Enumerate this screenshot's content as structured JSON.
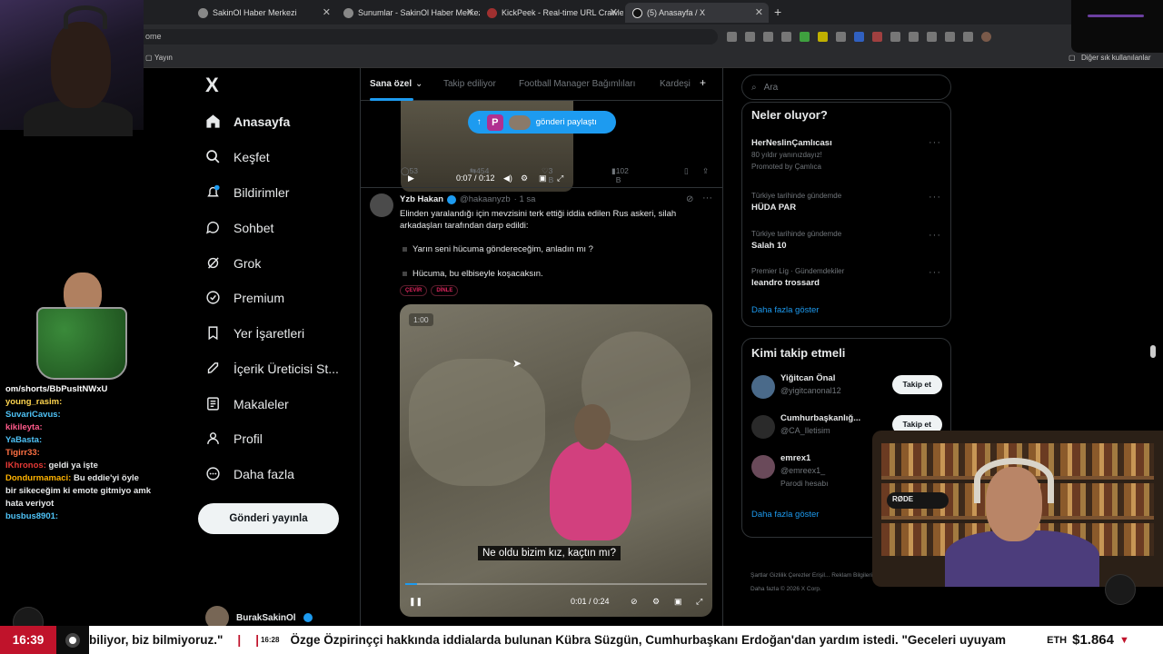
{
  "browser": {
    "tabs": [
      {
        "label": "SakinOl Haber Merkezi"
      },
      {
        "label": "Sunumlar - SakinOl Haber Merkezi"
      },
      {
        "label": "KickPeek - Real-time URL Crawler"
      },
      {
        "label": "(5) Anasayfa / X"
      }
    ],
    "address_fragment": "ome",
    "bookmarks": {
      "left": "Yayın",
      "right": "Diğer sık kullanılanlar"
    }
  },
  "x_nav": {
    "logo": "X",
    "items": [
      {
        "label": "Anasayfa",
        "icon": "home-icon"
      },
      {
        "label": "Keşfet",
        "icon": "search-icon"
      },
      {
        "label": "Bildirimler",
        "icon": "bell-icon"
      },
      {
        "label": "Sohbet",
        "icon": "chat-icon"
      },
      {
        "label": "Grok",
        "icon": "grok-icon"
      },
      {
        "label": "Premium",
        "icon": "premium-icon"
      },
      {
        "label": "Yer İşaretleri",
        "icon": "bookmark-icon"
      },
      {
        "label": "İçerik Üreticisi St...",
        "icon": "rocket-icon"
      },
      {
        "label": "Makaleler",
        "icon": "article-icon"
      },
      {
        "label": "Profil",
        "icon": "profile-icon"
      },
      {
        "label": "Daha fazla",
        "icon": "more-icon"
      }
    ],
    "post_button": "Gönderi yayınla",
    "account_name": "BurakSakinOl"
  },
  "feed": {
    "tabs": [
      "Sana özel",
      "Takip ediliyor",
      "Football Manager Bağımlıları",
      "Kardeşi"
    ],
    "share_pill": "gönderi paylaştı",
    "prev_video_time": "0:07 / 0:12",
    "prev_actions": {
      "replies": "53",
      "reposts": "454",
      "likes": "3 B",
      "views": "102 B"
    },
    "tweet": {
      "name": "Yzb Hakan",
      "handle": "@hakaanyzb",
      "time": "· 1 sa",
      "text": "Elinden yaralandığı için mevzisini terk ettiği iddia edilen Rus askeri, silah arkadaşları tarafından darp edildi:",
      "quote1": "Yarın seni hücuma göndereceğim, anladın mı ?",
      "quote2": "Hücuma, bu elbiseyle koşacaksın.",
      "pill1": "ÇEVİR",
      "pill2": "DİNLE",
      "video_badge": "1:00",
      "subtitle": "Ne oldu bizim kız, kaçtın mı?",
      "video_time": "0:01 / 0:24",
      "progress": 0.04
    }
  },
  "sidebar": {
    "search_placeholder": "Ara",
    "trends_title": "Neler oluyor?",
    "trends": [
      {
        "context": "",
        "title": "HerNeslinÇamlıcası",
        "sub1": "80 yıldır yanınızdayız!",
        "sub2": "Promoted by Çamlıca"
      },
      {
        "context": "Türkiye tarihinde gündemde",
        "title": "HÜDA PAR",
        "sub1": "",
        "sub2": ""
      },
      {
        "context": "Türkiye tarihinde gündemde",
        "title": "Salah 10",
        "sub1": "",
        "sub2": ""
      },
      {
        "context": "Premier Lig · Gündemdekiler",
        "title": "leandro trossard",
        "sub1": "",
        "sub2": ""
      }
    ],
    "trends_more": "Daha fazla göster",
    "who_title": "Kimi takip etmeli",
    "who": [
      {
        "name": "Yiğitcan Önal",
        "handle": "@yigitcanonal12",
        "extra": "",
        "button": "Takip et"
      },
      {
        "name": "Cumhurbaşkanlığ...",
        "handle": "@CA_Iletisim",
        "extra": "",
        "button": "Takip et"
      },
      {
        "name": "emrex1",
        "handle": "@emreex1_",
        "extra": "Parodi hesabı",
        "button": ""
      }
    ],
    "who_more": "Daha fazla göster",
    "footer": "Şartlar   Gizlilik   Çerezler   Erişil... Reklam Bilgileri   Daha fazla   © 2026 X Corp."
  },
  "chat": {
    "header": "om/shorts/BbPusltNWxU",
    "messages": [
      {
        "user": "young_rasim:",
        "text": "",
        "color": "#ffd54f"
      },
      {
        "user": "SuvariCavus:",
        "text": "",
        "color": "#4fc3f7"
      },
      {
        "user": "kikileyta:",
        "text": "",
        "color": "#ff5a8a"
      },
      {
        "user": "YaBasta:",
        "text": "",
        "color": "#4fc3f7"
      },
      {
        "user": "Tigirr33:",
        "text": "",
        "color": "#ff7043"
      },
      {
        "user": "IKhronos:",
        "text": "geldi ya işte",
        "color": "#e53935"
      },
      {
        "user": "Dondurmamaci:",
        "text": "Bu eddie'yi öyle bir sikeceğim ki emote gitmiyo amk hata veriyot",
        "color": "#ffb300"
      },
      {
        "user": "busbus8901:",
        "text": "",
        "color": "#4fc3f7"
      }
    ]
  },
  "ticker": {
    "clock": "16:39",
    "segment1": "biliyor, biz bilmiyoruz.\"",
    "time2": "16:28",
    "segment2": "Özge Özpirinççi hakkında iddialarda bulunan Kübra Süzgün, Cumhurbaşkanı Erdoğan'dan yardım istedi. \"Geceleri uyuyam",
    "eth_label": "ETH",
    "eth_value": "$1.864",
    "eth_arrow": "▼"
  },
  "overlay": {
    "cam_mic_text": "RØDE"
  },
  "colors": {
    "accent": "#1d9bf0",
    "ticker_red": "#c0132b",
    "tag_red": "#e0245e"
  }
}
